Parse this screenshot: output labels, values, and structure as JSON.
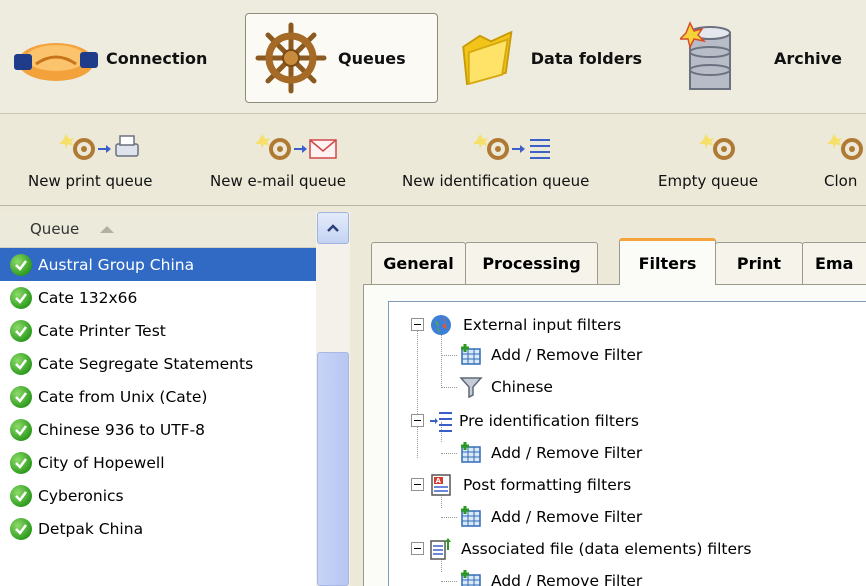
{
  "navbar": {
    "items": [
      {
        "label": "Connection",
        "icon": "handshake-icon"
      },
      {
        "label": "Queues",
        "icon": "ship-wheel-icon",
        "active": true
      },
      {
        "label": "Data folders",
        "icon": "folder-icon"
      },
      {
        "label": "Archive",
        "icon": "database-icon"
      }
    ]
  },
  "toolbar": {
    "items": [
      {
        "label": "New print queue",
        "icon": "new-print-queue-icon"
      },
      {
        "label": "New e-mail queue",
        "icon": "new-email-queue-icon"
      },
      {
        "label": "New identification queue",
        "icon": "new-identification-queue-icon"
      },
      {
        "label": "Empty queue",
        "icon": "empty-queue-icon"
      },
      {
        "label": "Clon",
        "icon": "clone-queue-icon"
      }
    ]
  },
  "queue_list": {
    "header": "Queue",
    "rows": [
      {
        "label": "Austral Group China",
        "selected": true
      },
      {
        "label": "Cate 132x66"
      },
      {
        "label": "Cate Printer Test"
      },
      {
        "label": "Cate Segregate Statements"
      },
      {
        "label": "Cate from Unix (Cate)"
      },
      {
        "label": "Chinese 936 to UTF-8"
      },
      {
        "label": "City of Hopewell"
      },
      {
        "label": "Cyberonics"
      },
      {
        "label": "Detpak China"
      }
    ]
  },
  "tabs": [
    {
      "label": "General"
    },
    {
      "label": "Processing"
    },
    {
      "label": "Filters",
      "active": true
    },
    {
      "label": "Print"
    },
    {
      "label": "Ema"
    }
  ],
  "filter_tree": {
    "groups": [
      {
        "label": "External input filters",
        "icon": "globe-icon",
        "children": [
          "Add / Remove Filter",
          "Chinese"
        ]
      },
      {
        "label": "Pre identification filters",
        "icon": "list-arrow-icon",
        "children": [
          "Add / Remove Filter"
        ]
      },
      {
        "label": "Post formatting filters",
        "icon": "text-format-icon",
        "children": [
          "Add / Remove Filter"
        ]
      },
      {
        "label": "Associated file (data elements) filters",
        "icon": "data-elements-icon",
        "children": [
          "Add / Remove Filter"
        ]
      }
    ]
  },
  "colors": {
    "selection": "#316ac5",
    "active_tab_accent": "#f5a23a",
    "check_green": "#2f9d1f"
  }
}
